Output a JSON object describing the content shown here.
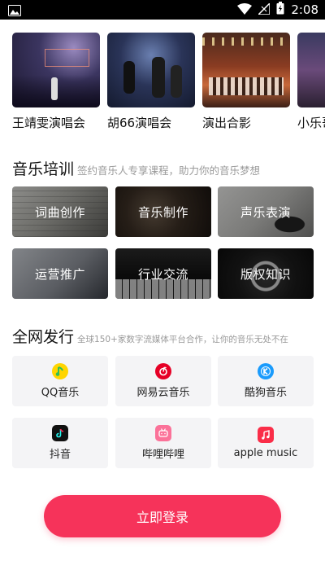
{
  "status_bar": {
    "time": "2:08"
  },
  "concerts": [
    {
      "label": "王靖雯演唱会"
    },
    {
      "label": "胡66演唱会"
    },
    {
      "label": "演出合影"
    },
    {
      "label": "小乐哥"
    }
  ],
  "training": {
    "title": "音乐培训",
    "subtitle": "签约音乐人专享课程，助力你的音乐梦想",
    "tiles": [
      {
        "label": "词曲创作"
      },
      {
        "label": "音乐制作"
      },
      {
        "label": "声乐表演"
      },
      {
        "label": "运营推广"
      },
      {
        "label": "行业交流"
      },
      {
        "label": "版权知识"
      }
    ]
  },
  "distribution": {
    "title": "全网发行",
    "subtitle": "全球150+家数字流媒体平台合作，让你的音乐无处不在",
    "platforms": [
      {
        "name": "QQ音乐",
        "icon": "qq-music-icon",
        "color": "#2ebd59"
      },
      {
        "name": "网易云音乐",
        "icon": "netease-music-icon",
        "color": "#e60026"
      },
      {
        "name": "酷狗音乐",
        "icon": "kugou-music-icon",
        "color": "#1a9bfc"
      },
      {
        "name": "抖音",
        "icon": "douyin-icon",
        "color": "#111111"
      },
      {
        "name": "哔哩哔哩",
        "icon": "bilibili-icon",
        "color": "#fb7299"
      },
      {
        "name": "apple music",
        "icon": "apple-music-icon",
        "color": "#fa2d48"
      }
    ]
  },
  "login": {
    "label": "立即登录"
  },
  "colors": {
    "accent": "#f6335a",
    "tile_bg": "#f4f4f6"
  }
}
